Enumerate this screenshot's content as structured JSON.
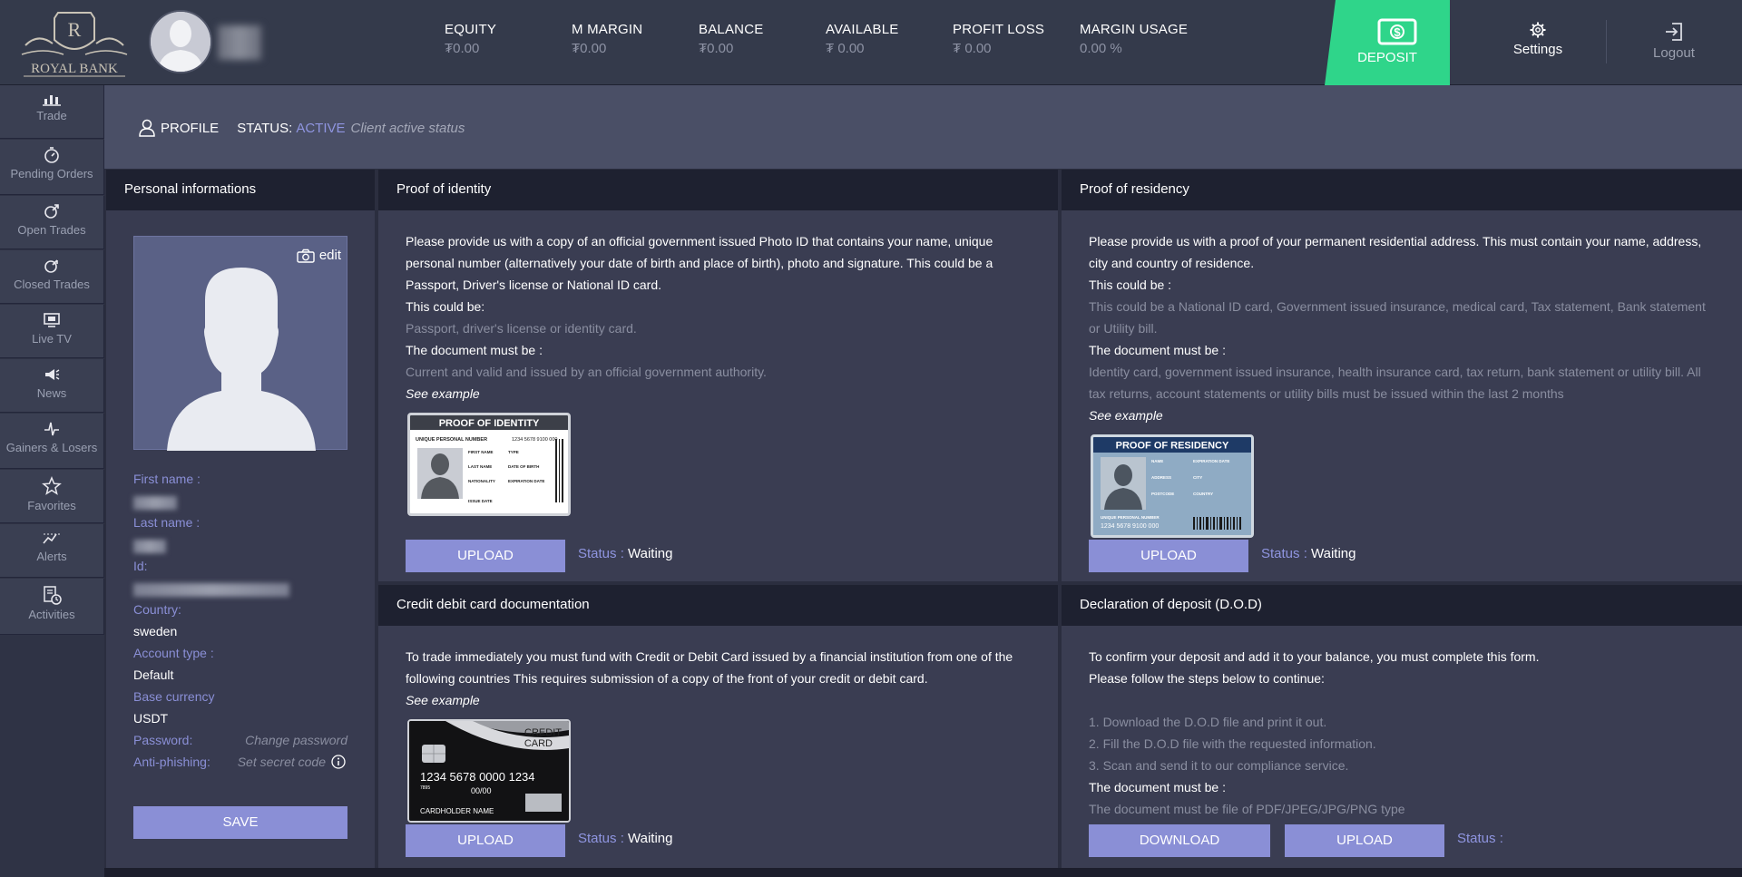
{
  "header": {
    "logo_text": "ROYAL BANK",
    "stats": [
      {
        "label": "EQUITY",
        "value": "₮0.00"
      },
      {
        "label": "M MARGIN",
        "value": "₮0.00"
      },
      {
        "label": "BALANCE",
        "value": "₮0.00"
      },
      {
        "label": "AVAILABLE",
        "value": "₮ 0.00"
      },
      {
        "label": "PROFIT LOSS",
        "value": "₮ 0.00"
      },
      {
        "label": "MARGIN USAGE",
        "value": "0.00 %"
      }
    ],
    "deposit_label": "DEPOSIT",
    "settings_label": "Settings",
    "logout_label": "Logout",
    "deposit_color": "#2fd58a"
  },
  "sidebar": {
    "items": [
      {
        "label": "Trade",
        "icon": "trade-icon"
      },
      {
        "label": "Pending Orders",
        "icon": "pending-orders-icon"
      },
      {
        "label": "Open Trades",
        "icon": "open-trades-icon"
      },
      {
        "label": "Closed Trades",
        "icon": "closed-trades-icon"
      },
      {
        "label": "Live TV",
        "icon": "live-tv-icon"
      },
      {
        "label": "News",
        "icon": "news-icon"
      },
      {
        "label": "Gainers & Losers",
        "icon": "gainers-losers-icon"
      },
      {
        "label": "Favorites",
        "icon": "favorites-icon"
      },
      {
        "label": "Alerts",
        "icon": "alerts-icon"
      },
      {
        "label": "Activities",
        "icon": "activities-icon"
      }
    ]
  },
  "profile": {
    "title": "PROFILE",
    "status_label": "STATUS:",
    "status_value": "ACTIVE",
    "status_desc": "Client active status"
  },
  "personal": {
    "title": "Personal informations",
    "edit_label": "edit",
    "first_name_label": "First name :",
    "last_name_label": "Last name :",
    "id_label": "Id:",
    "country_label": "Country:",
    "country_value": "sweden",
    "account_type_label": "Account type :",
    "account_type_value": "Default",
    "base_currency_label": "Base currency",
    "base_currency_value": "USDT",
    "password_label": "Password:",
    "password_action": "Change password",
    "antiphishing_label": "Anti-phishing:",
    "antiphishing_action": "Set secret code",
    "save_label": "SAVE"
  },
  "identity": {
    "title": "Proof of identity",
    "intro": "Please provide us with a copy of an official government issued Photo ID that contains your name, unique personal number (alternatively your date of birth and place of birth), photo and signature. This could be a Passport, Driver's license or National ID card.",
    "could_be_label": "This could be:",
    "could_be_value": "Passport, driver's license or identity card.",
    "must_be_label": "The document must be :",
    "must_be_value": "Current and valid and issued by an official government authority.",
    "see_example": "See example",
    "card_title": "PROOF OF IDENTITY",
    "card_upn": "UNIQUE PERSONAL NUMBER",
    "card_upn_value": "1234 5678 9100 000",
    "card_fields": [
      "FIRST NAME",
      "TYPE",
      "LAST NAME",
      "DATE OF BIRTH",
      "NATIONALITY",
      "EXPIRATION DATE",
      "ISSUE DATE"
    ],
    "upload_label": "UPLOAD",
    "status_key": "Status :",
    "status_value": "Waiting"
  },
  "residency": {
    "title": "Proof of residency",
    "intro": "Please provide us with a proof of your permanent residential address. This must contain your name, address, city and country of residence.",
    "could_be_label": "This could be :",
    "could_be_value": "This could be a National ID card, Government issued insurance, medical card, Tax statement, Bank statement or Utility bill.",
    "must_be_label": "The document must be :",
    "must_be_value": "Identity card, government issued insurance, health insurance card, tax return, bank statement or utility bill. All tax returns, account statements or utility bills must be issued within the last 2 months",
    "see_example": "See example",
    "card_title": "PROOF OF RESIDENCY",
    "card_fields": [
      "NAME",
      "EXPIRATION DATE",
      "ADDRESS",
      "CITY",
      "POSTCODE",
      "COUNTRY",
      "UNIQUE PERSONAL NUMBER"
    ],
    "card_upn_value": "1234 5678 9100 000",
    "upload_label": "UPLOAD",
    "status_key": "Status :",
    "status_value": "Waiting"
  },
  "creditcard": {
    "title": "Credit debit card documentation",
    "intro": "To trade immediately you must fund with Credit or Debit Card issued by a financial institution from one of the following countries This requires submission of a copy of the front of your credit or debit card.",
    "see_example": "See example",
    "card_title_1": "CREDIT",
    "card_title_2": "CARD",
    "card_number": "1234  5678   0000  1234",
    "card_small": "7895",
    "card_valid": "00/00",
    "card_holder": "CARDHOLDER NAME",
    "upload_label": "UPLOAD",
    "status_key": "Status :",
    "status_value": "Waiting"
  },
  "dod": {
    "title": "Declaration of deposit (D.O.D)",
    "intro1": "To confirm your deposit and add it to your balance, you must complete this form.",
    "intro2": "Please follow the steps below to continue:",
    "step1": "1. Download the D.O.D file and print it out.",
    "step2": "2. Fill the D.O.D file with the requested information.",
    "step3": "3. Scan and send it to our compliance service.",
    "must_be_label": "The document must be :",
    "must_be_value": "The document must be file of PDF/JPEG/JPG/PNG type",
    "download_label": "DOWNLOAD",
    "upload_label": "UPLOAD",
    "status_key": "Status :"
  }
}
